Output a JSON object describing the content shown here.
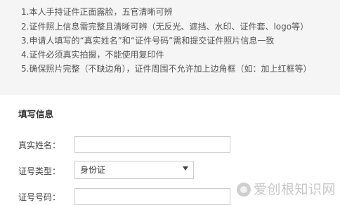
{
  "notice": {
    "lines": [
      "1.本人手持证件正面露脸，五官清晰可辨",
      "2.证件照上信息需完整且清晰可辨（无反光、遮挡、水印、证件套、logo等）",
      "3.申请人填写的“真实姓名”和“证件号码”需和提交证件照片信息一致",
      "4.证件必须真实拍摄，不能使用复印件",
      "5.确保照片完整（不缺边角），证件周围不允许加上边角框（如：加上红框等）"
    ]
  },
  "form": {
    "section_title": "填写信息",
    "real_name_label": "真实姓名：",
    "id_type_label": "证号类型：",
    "id_type_value": "身份证",
    "id_number_label": "证号号码："
  },
  "watermark": {
    "text": "爱创根知识网"
  }
}
